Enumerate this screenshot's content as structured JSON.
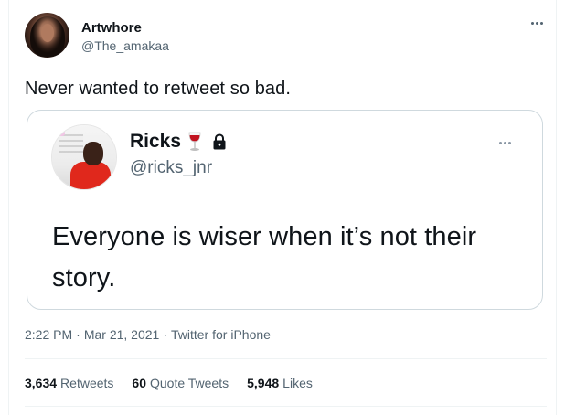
{
  "tweet": {
    "author": {
      "display_name": "Artwhore",
      "handle": "@The_amakaa",
      "avatar_icon": "profile-photo"
    },
    "text": "Never wanted to retweet so bad.",
    "more_icon": "more-horizontal-icon"
  },
  "quoted_tweet": {
    "author": {
      "display_name": "Ricks",
      "handle": "@ricks_jnr",
      "emoji_icon": "wine-glass-icon",
      "protected_icon": "lock-icon",
      "avatar_icon": "profile-photo"
    },
    "text": "Everyone is wiser when it’s not their story."
  },
  "meta": {
    "time": "2:22 PM",
    "separator": "·",
    "date": "Mar 21, 2021",
    "source": "Twitter for iPhone"
  },
  "stats": [
    {
      "count": "3,634",
      "label": "Retweets"
    },
    {
      "count": "60",
      "label": "Quote Tweets"
    },
    {
      "count": "5,948",
      "label": "Likes"
    }
  ],
  "colors": {
    "text_primary": "#0f1419",
    "text_secondary": "#536471",
    "border": "#cfd9de",
    "divider": "#eff3f4"
  }
}
